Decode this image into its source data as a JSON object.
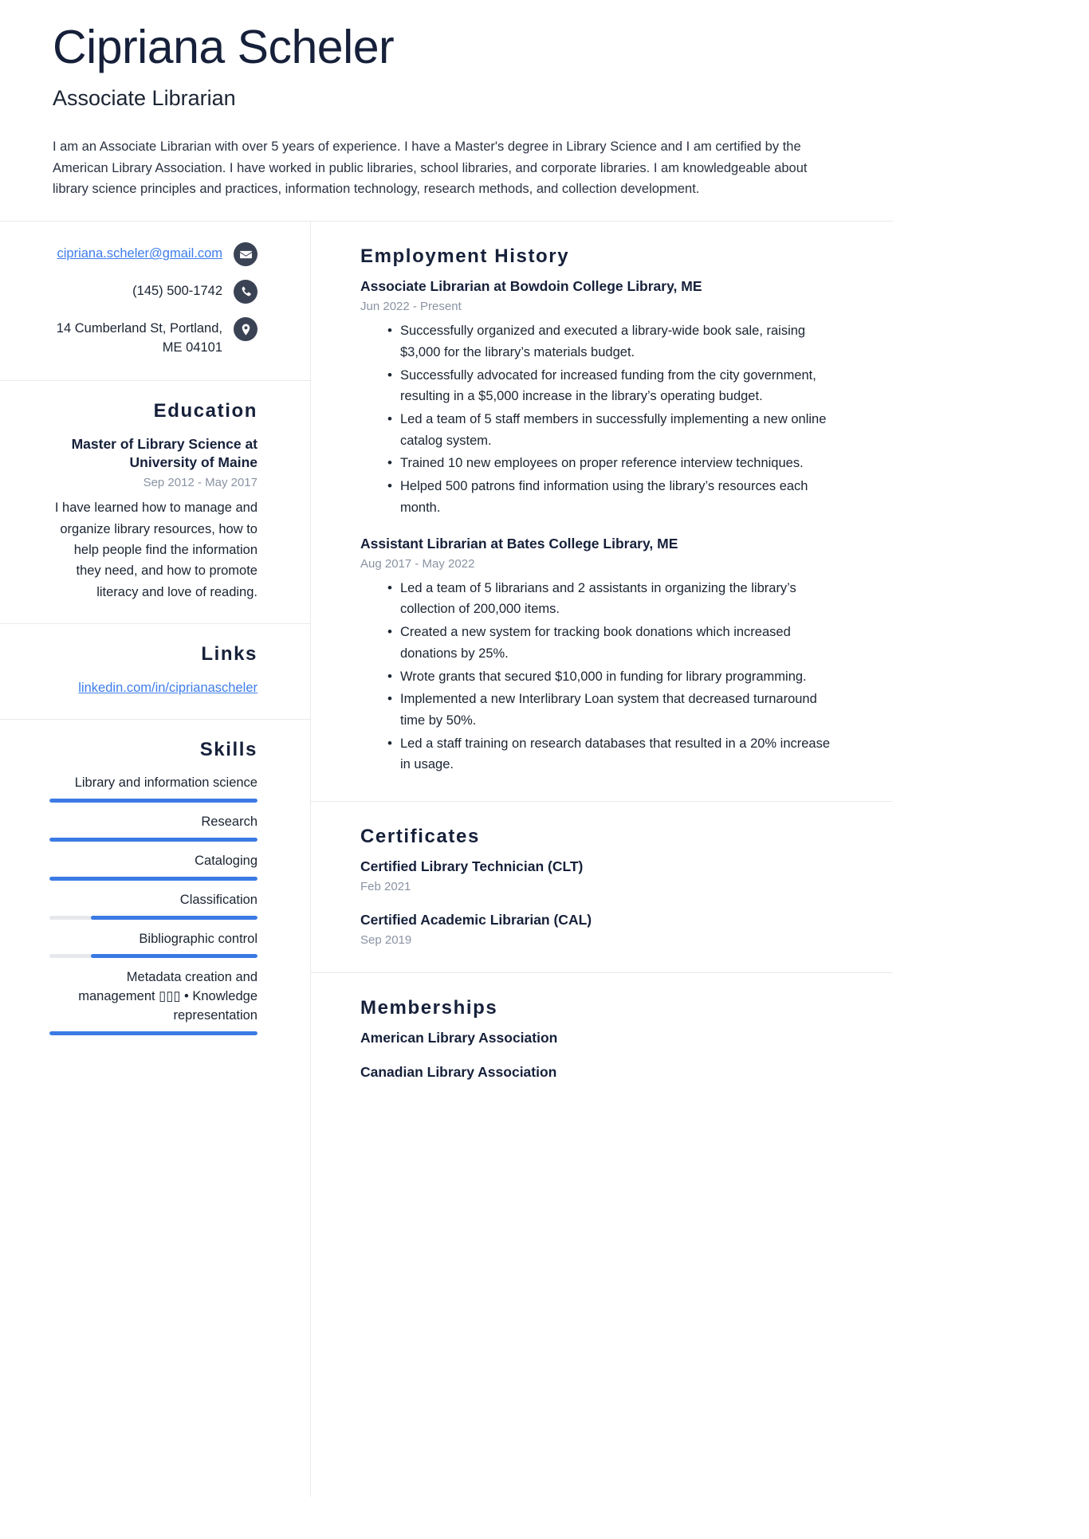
{
  "header": {
    "full_name": "Cipriana Scheler",
    "job_title": "Associate Librarian",
    "summary": "I am an Associate Librarian with over 5 years of experience. I have a Master's degree in Library Science and I am certified by the American Library Association. I have worked in public libraries, school libraries, and corporate libraries. I am knowledgeable about library science principles and practices, information technology, research methods, and collection development."
  },
  "colors": {
    "accent_link": "#3e7dea",
    "skill_bar": "#3b7ae4",
    "skill_track": "#e6e8ec",
    "icon_circle": "#3a4354",
    "heading": "#16203a",
    "muted_date": "#8a93a3"
  },
  "contact": {
    "email": "cipriana.scheler@gmail.com",
    "email_icon": "envelope-icon",
    "phone": "(145) 500-1742",
    "phone_icon": "phone-icon",
    "address": "14 Cumberland St, Portland, ME 04101",
    "address_icon": "location-pin-icon"
  },
  "education": {
    "title": "Education",
    "entries": [
      {
        "degree": "Master of Library Science at University of Maine",
        "date": "Sep 2012 - May 2017",
        "description": "I have learned how to manage and organize library resources, how to help people find the information they need, and how to promote literacy and love of reading."
      }
    ]
  },
  "links": {
    "title": "Links",
    "items": [
      {
        "label": "linkedin.com/in/ciprianascheler"
      }
    ]
  },
  "skills": {
    "title": "Skills",
    "items": [
      {
        "name": "Library and information science",
        "level": 100
      },
      {
        "name": "Research",
        "level": 100
      },
      {
        "name": "Cataloging",
        "level": 100
      },
      {
        "name": "Classification",
        "level": 80
      },
      {
        "name": "Bibliographic control",
        "level": 80
      },
      {
        "name": "Metadata creation and management ▯▯▯ • Knowledge representation",
        "level": 100
      }
    ]
  },
  "employment": {
    "title": "Employment History",
    "entries": [
      {
        "role": "Associate Librarian at Bowdoin College Library, ME",
        "date": "Jun 2022 - Present",
        "bullets": [
          "Successfully organized and executed a library-wide book sale, raising $3,000 for the library’s materials budget.",
          "Successfully advocated for increased funding from the city government, resulting in a $5,000 increase in the library’s operating budget.",
          "Led a team of 5 staff members in successfully implementing a new online catalog system.",
          "Trained 10 new employees on proper reference interview techniques.",
          "Helped 500 patrons find information using the library’s resources each month."
        ]
      },
      {
        "role": "Assistant Librarian at Bates College Library, ME",
        "date": "Aug 2017 - May 2022",
        "bullets": [
          "Led a team of 5 librarians and 2 assistants in organizing the library’s collection of 200,000 items.",
          "Created a new system for tracking book donations which increased donations by 25%.",
          "Wrote grants that secured $10,000 in funding for library programming.",
          "Implemented a new Interlibrary Loan system that decreased turnaround time by 50%.",
          "Led a staff training on research databases that resulted in a 20% increase in usage."
        ]
      }
    ]
  },
  "certificates": {
    "title": "Certificates",
    "entries": [
      {
        "name": "Certified Library Technician (CLT)",
        "date": "Feb 2021"
      },
      {
        "name": "Certified Academic Librarian (CAL)",
        "date": "Sep 2019"
      }
    ]
  },
  "memberships": {
    "title": "Memberships",
    "entries": [
      {
        "name": "American Library Association"
      },
      {
        "name": "Canadian Library Association"
      }
    ]
  }
}
